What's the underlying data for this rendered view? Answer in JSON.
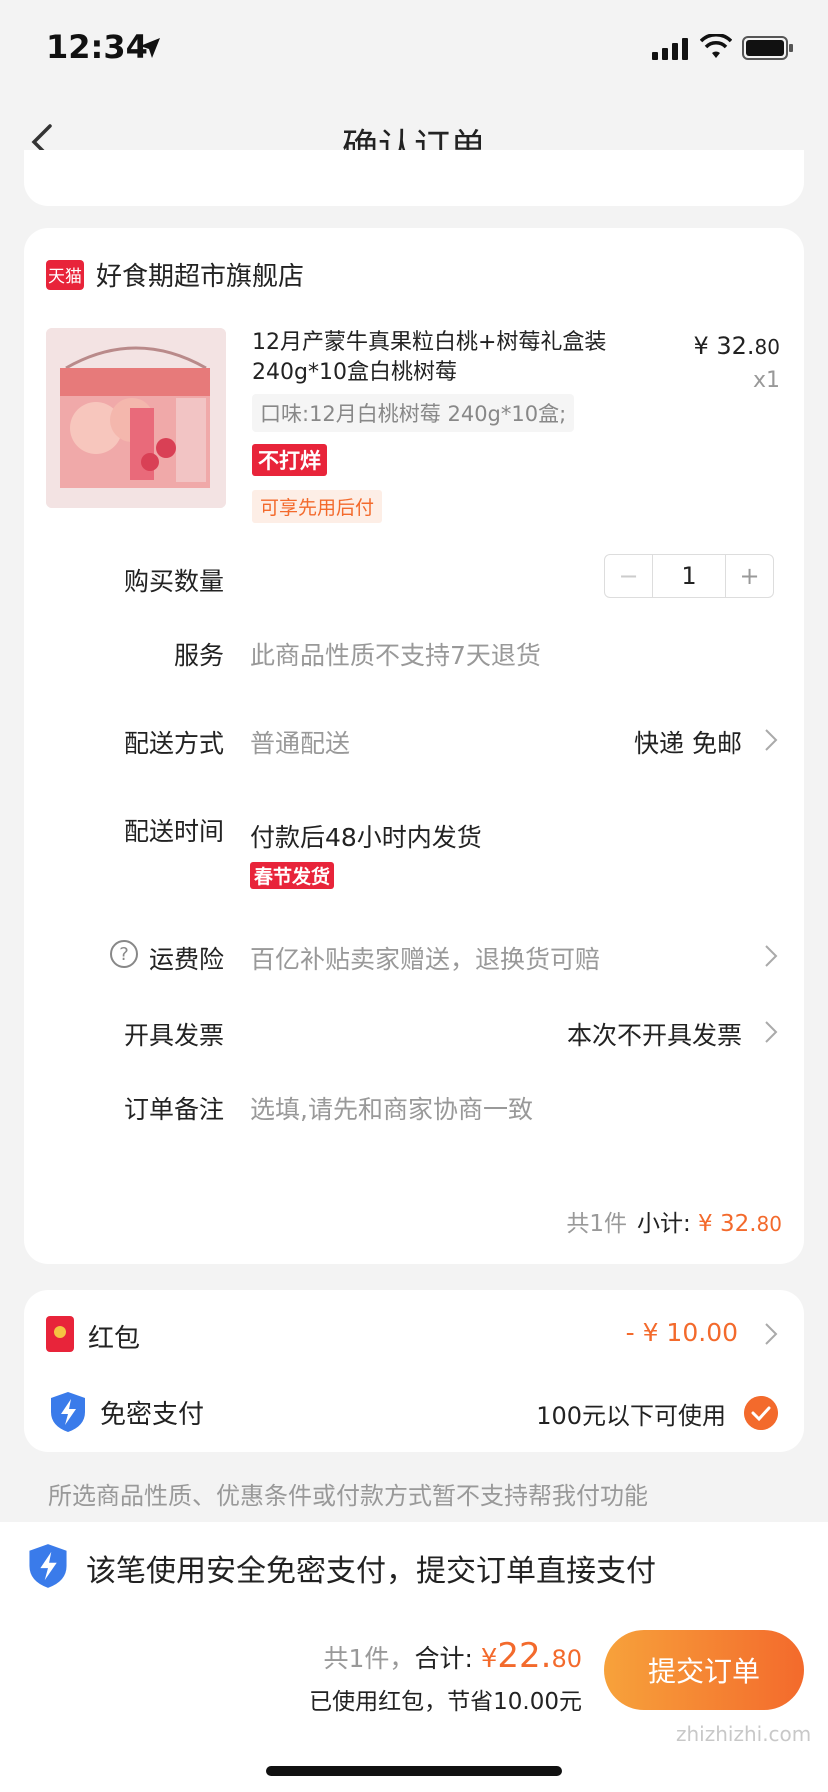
{
  "status_bar": {
    "time": "12:34"
  },
  "nav": {
    "title": "确认订单"
  },
  "shop": {
    "badge": "天猫",
    "name": "好食期超市旗舰店"
  },
  "product": {
    "title": "12月产蒙牛真果粒白桃+树莓礼盒装240g*10盒白桃树莓",
    "price_yen": "¥ 32.",
    "price_cents": "80",
    "quantity_label": "x1",
    "flavor": "口味:12月白桃树莓 240g*10盒;",
    "tag_no_discount": "不打烊",
    "tag_pay_later": "可享先用后付"
  },
  "rows": {
    "quantity": {
      "label": "购买数量",
      "minus": "−",
      "value": "1",
      "plus": "+"
    },
    "service": {
      "label": "服务",
      "value": "此商品性质不支持7天退货"
    },
    "delivery": {
      "label": "配送方式",
      "value": "普通配送",
      "right": "快递 免邮"
    },
    "delivery_time": {
      "label": "配送时间",
      "value": "付款后48小时内发货",
      "tag": "春节发货"
    },
    "shipping_insurance": {
      "help": "?",
      "label": "运费险",
      "value": "百亿补贴卖家赠送，退换货可赔"
    },
    "invoice": {
      "label": "开具发票",
      "right": "本次不开具发票"
    },
    "note": {
      "label": "订单备注",
      "placeholder": "选填,请先和商家协商一致"
    }
  },
  "subtotal": {
    "count": "共1件",
    "label": "小计:",
    "yen": "¥ 32.",
    "cents": "80"
  },
  "red_packet": {
    "label": "红包",
    "value": "- ¥ 10.00"
  },
  "password_free": {
    "label": "免密支付",
    "value": "100元以下可使用",
    "checked": true
  },
  "notice": "所选商品性质、优惠条件或付款方式暂不支持帮我付功能",
  "bottom": {
    "secure_text": "该笔使用安全免密支付，提交订单直接支付",
    "count": "共1件，",
    "total_label": "合计:",
    "total_yen": "¥",
    "total_big": "22.",
    "total_small": "80",
    "saved": "已使用红包，节省10.00元",
    "submit": "提交订单",
    "watermark": "zhizhizhi.com"
  },
  "colors": {
    "accent": "#f36a2c",
    "tmall_red": "#e8243a",
    "shield_blue": "#3a7bea"
  }
}
